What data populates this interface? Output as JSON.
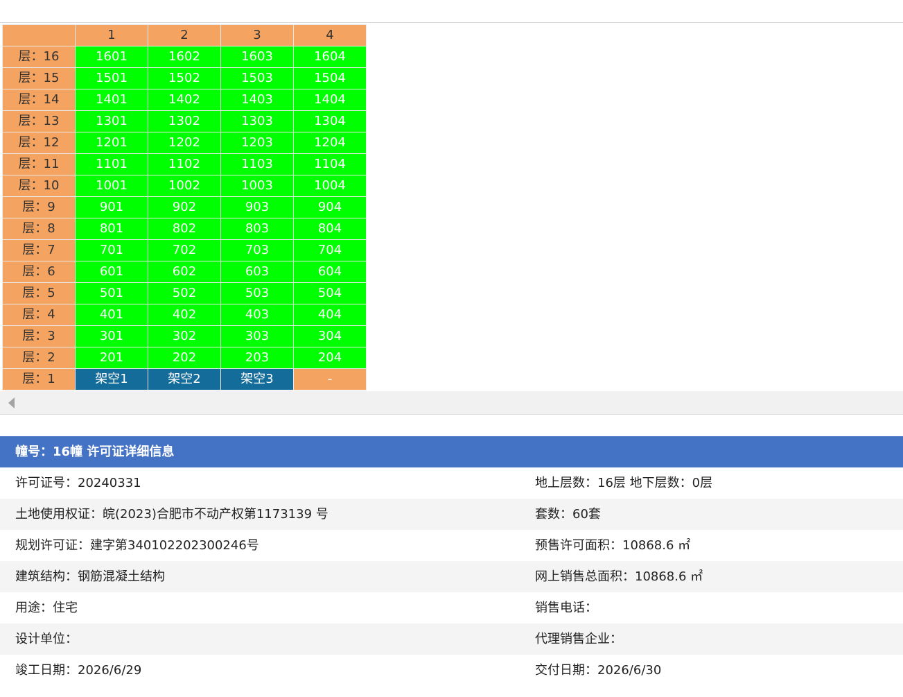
{
  "columns": [
    "",
    "1",
    "2",
    "3",
    "4"
  ],
  "floors": [
    {
      "label": "层：16",
      "units": [
        {
          "t": "1601",
          "k": "unit"
        },
        {
          "t": "1602",
          "k": "unit"
        },
        {
          "t": "1603",
          "k": "unit"
        },
        {
          "t": "1604",
          "k": "unit"
        }
      ]
    },
    {
      "label": "层：15",
      "units": [
        {
          "t": "1501",
          "k": "unit"
        },
        {
          "t": "1502",
          "k": "unit"
        },
        {
          "t": "1503",
          "k": "unit"
        },
        {
          "t": "1504",
          "k": "unit"
        }
      ]
    },
    {
      "label": "层：14",
      "units": [
        {
          "t": "1401",
          "k": "unit"
        },
        {
          "t": "1402",
          "k": "unit"
        },
        {
          "t": "1403",
          "k": "unit"
        },
        {
          "t": "1404",
          "k": "unit"
        }
      ]
    },
    {
      "label": "层：13",
      "units": [
        {
          "t": "1301",
          "k": "unit"
        },
        {
          "t": "1302",
          "k": "unit"
        },
        {
          "t": "1303",
          "k": "unit"
        },
        {
          "t": "1304",
          "k": "unit"
        }
      ]
    },
    {
      "label": "层：12",
      "units": [
        {
          "t": "1201",
          "k": "unit"
        },
        {
          "t": "1202",
          "k": "unit"
        },
        {
          "t": "1203",
          "k": "unit"
        },
        {
          "t": "1204",
          "k": "unit"
        }
      ]
    },
    {
      "label": "层：11",
      "units": [
        {
          "t": "1101",
          "k": "unit"
        },
        {
          "t": "1102",
          "k": "unit"
        },
        {
          "t": "1103",
          "k": "unit"
        },
        {
          "t": "1104",
          "k": "unit"
        }
      ]
    },
    {
      "label": "层：10",
      "units": [
        {
          "t": "1001",
          "k": "unit"
        },
        {
          "t": "1002",
          "k": "unit"
        },
        {
          "t": "1003",
          "k": "unit"
        },
        {
          "t": "1004",
          "k": "unit"
        }
      ]
    },
    {
      "label": "层：9",
      "units": [
        {
          "t": "901",
          "k": "unit"
        },
        {
          "t": "902",
          "k": "unit"
        },
        {
          "t": "903",
          "k": "unit"
        },
        {
          "t": "904",
          "k": "unit"
        }
      ]
    },
    {
      "label": "层：8",
      "units": [
        {
          "t": "801",
          "k": "unit"
        },
        {
          "t": "802",
          "k": "unit"
        },
        {
          "t": "803",
          "k": "unit"
        },
        {
          "t": "804",
          "k": "unit"
        }
      ]
    },
    {
      "label": "层：7",
      "units": [
        {
          "t": "701",
          "k": "unit"
        },
        {
          "t": "702",
          "k": "unit"
        },
        {
          "t": "703",
          "k": "unit"
        },
        {
          "t": "704",
          "k": "unit"
        }
      ]
    },
    {
      "label": "层：6",
      "units": [
        {
          "t": "601",
          "k": "unit"
        },
        {
          "t": "602",
          "k": "unit"
        },
        {
          "t": "603",
          "k": "unit"
        },
        {
          "t": "604",
          "k": "unit"
        }
      ]
    },
    {
      "label": "层：5",
      "units": [
        {
          "t": "501",
          "k": "unit"
        },
        {
          "t": "502",
          "k": "unit"
        },
        {
          "t": "503",
          "k": "unit"
        },
        {
          "t": "504",
          "k": "unit"
        }
      ]
    },
    {
      "label": "层：4",
      "units": [
        {
          "t": "401",
          "k": "unit"
        },
        {
          "t": "402",
          "k": "unit"
        },
        {
          "t": "403",
          "k": "unit"
        },
        {
          "t": "404",
          "k": "unit"
        }
      ]
    },
    {
      "label": "层：3",
      "units": [
        {
          "t": "301",
          "k": "unit"
        },
        {
          "t": "302",
          "k": "unit"
        },
        {
          "t": "303",
          "k": "unit"
        },
        {
          "t": "304",
          "k": "unit"
        }
      ]
    },
    {
      "label": "层：2",
      "units": [
        {
          "t": "201",
          "k": "unit"
        },
        {
          "t": "202",
          "k": "unit"
        },
        {
          "t": "203",
          "k": "unit"
        },
        {
          "t": "204",
          "k": "unit"
        }
      ]
    },
    {
      "label": "层：1",
      "units": [
        {
          "t": "架空1",
          "k": "void"
        },
        {
          "t": "架空2",
          "k": "void"
        },
        {
          "t": "架空3",
          "k": "void"
        },
        {
          "t": "-",
          "k": "empty"
        }
      ]
    }
  ],
  "colors": {
    "floor_bg": "#f4a460",
    "available": "#00ff00",
    "void": "#136c9a",
    "panel_header": "#4472c4"
  },
  "scroll_icon": "arrow-left-icon",
  "panel": {
    "title": "幢号：16幢 许可证详细信息",
    "rows": [
      {
        "left": "许可证号：20240331",
        "right": "地上层数：16层  地下层数：0层"
      },
      {
        "left": "土地使用权证：皖(2023)合肥市不动产权第1173139 号",
        "right": "套数：60套"
      },
      {
        "left": "规划许可证：建字第340102202300246号",
        "right": "预售许可面积：10868.6 ㎡"
      },
      {
        "left": "建筑结构：钢筋混凝土结构",
        "right": "网上销售总面积：10868.6 ㎡"
      },
      {
        "left": "用途：住宅",
        "right": "销售电话："
      },
      {
        "left": "设计单位：",
        "right": "代理销售企业："
      },
      {
        "left": "竣工日期：2026/6/29",
        "right": "交付日期：2026/6/30"
      }
    ]
  }
}
